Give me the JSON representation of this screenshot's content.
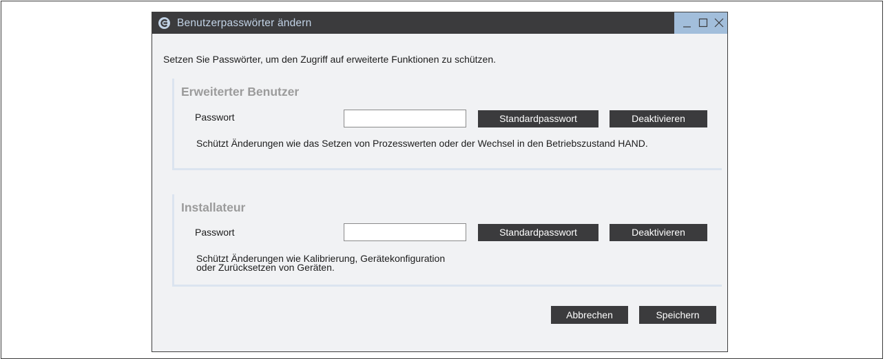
{
  "window": {
    "title": "Benutzerpasswörter ändern",
    "icon": "app-logo-icon",
    "controls": [
      "minimize-icon",
      "maximize-icon",
      "close-icon"
    ]
  },
  "intro_text": "Setzen Sie Passwörter, um den Zugriff auf erweiterte Funktionen zu schützen.",
  "groups": {
    "advanced_user": {
      "title": "Erweiterter Benutzer",
      "password_label": "Passwort",
      "password_value": "",
      "default_button": "Standardpasswort",
      "disable_button": "Deaktivieren",
      "description": "Schützt Änderungen wie das Setzen von Prozesswerten oder der Wechsel in den Betriebszustand HAND."
    },
    "installer": {
      "title": "Installateur",
      "password_label": "Passwort",
      "password_value": "",
      "default_button": "Standardpasswort",
      "disable_button": "Deaktivieren",
      "description_lines": [
        "Schützt Änderungen wie Kalibrierung, Gerätekonfiguration",
        "oder Zurücksetzen von Geräten."
      ]
    }
  },
  "footer": {
    "cancel_label": "Abbrechen",
    "save_label": "Speichern"
  },
  "colors": {
    "titlebar": "#3b3b3d",
    "title_text": "#c2d3e6",
    "window_controls_bg": "#a2bedb",
    "dialog_bg": "#f1f2f4",
    "group_border": "#dbe4ef",
    "group_title": "#9b9b9b",
    "button_bg": "#3b3b3d",
    "button_text": "#ffffff"
  }
}
